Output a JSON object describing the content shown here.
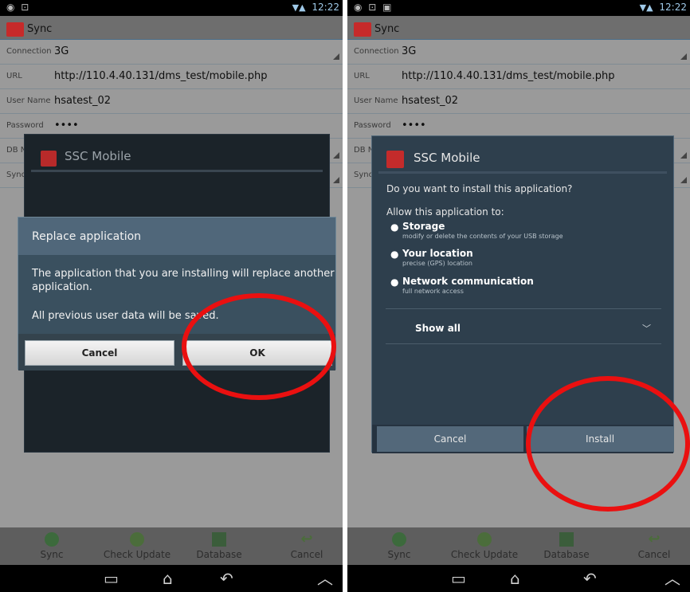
{
  "left": {
    "status_time": "12:22",
    "app_title": "Sync",
    "form": {
      "connection_label": "Connection",
      "connection_value": "3G",
      "url_label": "URL",
      "url_value": "http://110.4.40.131/dms_test/mobile.php",
      "user_label": "User Name",
      "user_value": "hsatest_02",
      "password_label": "Password",
      "password_value": "••••",
      "db_label": "DB N",
      "sync_label": "Sync"
    },
    "background_dialog_title": "SSC Mobile",
    "replace_dialog": {
      "title": "Replace application",
      "message": "The application that you are installing will replace another application.",
      "note": "All previous user data will be saved.",
      "cancel_label": "Cancel",
      "ok_label": "OK"
    },
    "bottom": {
      "sync": "Sync",
      "check_update": "Check Update",
      "database": "Database",
      "cancel": "Cancel"
    }
  },
  "right": {
    "status_time": "12:22",
    "app_title": "Sync",
    "form": {
      "connection_label": "Connection",
      "connection_value": "3G",
      "url_label": "URL",
      "url_value": "http://110.4.40.131/dms_test/mobile.php",
      "user_label": "User Name",
      "user_value": "hsatest_02",
      "password_label": "Password",
      "password_value": "••••",
      "db_label": "DB N",
      "sync_label": "Sync"
    },
    "install_dialog": {
      "title": "SSC Mobile",
      "question": "Do you want to install this application?",
      "allow": "Allow this application to:",
      "permissions": [
        {
          "title": "Storage",
          "desc": "modify or delete the contents of your USB storage"
        },
        {
          "title": "Your location",
          "desc": "precise (GPS) location"
        },
        {
          "title": "Network communication",
          "desc": "full network access"
        }
      ],
      "show_all": "Show all",
      "cancel_label": "Cancel",
      "install_label": "Install"
    },
    "bottom": {
      "sync": "Sync",
      "check_update": "Check Update",
      "database": "Database",
      "cancel": "Cancel"
    }
  },
  "icons": {
    "home": "home-icon",
    "back": "back-icon",
    "recent": "recent-apps-icon",
    "menu": "up-chevron-icon"
  },
  "colors": {
    "annotation": "#ea1010",
    "dialog": "#3a505f"
  }
}
